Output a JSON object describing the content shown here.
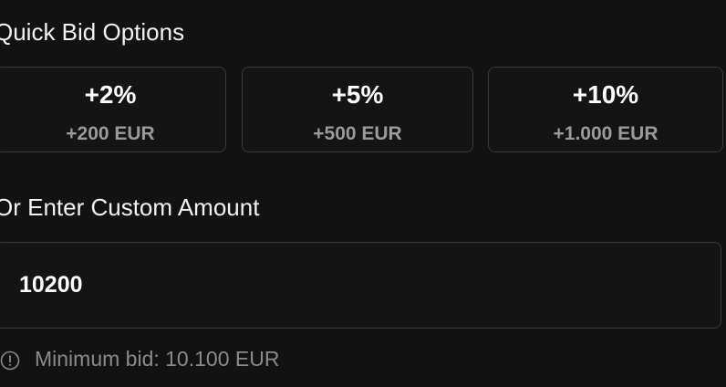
{
  "quick_bid": {
    "title": "Quick Bid Options",
    "options": [
      {
        "percent": "+2%",
        "amount": "+200 EUR"
      },
      {
        "percent": "+5%",
        "amount": "+500 EUR"
      },
      {
        "percent": "+10%",
        "amount": "+1.000 EUR"
      }
    ]
  },
  "custom": {
    "title": "Or Enter Custom Amount",
    "value": "10200"
  },
  "hint": {
    "icon": "info-circle-icon",
    "text": "Minimum bid: 10.100 EUR"
  },
  "colors": {
    "background": "#121212",
    "border": "#3a3a3a",
    "muted_text": "#9a9a9a"
  }
}
